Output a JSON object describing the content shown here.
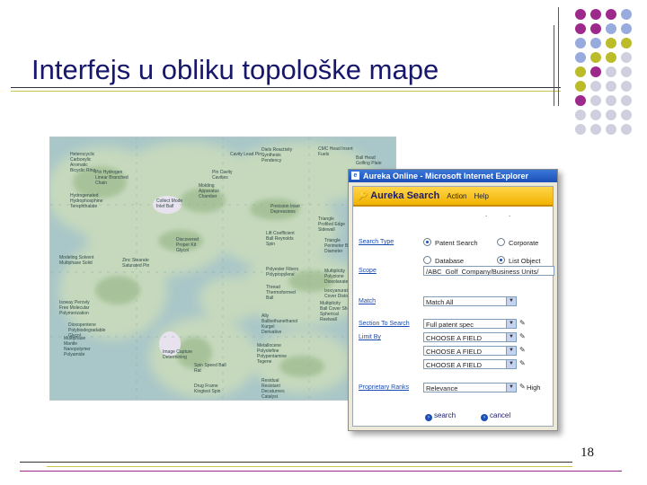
{
  "slide": {
    "title": "Interfejs u obliku topološke mape",
    "page_number": "18",
    "colors": {
      "title": "#17176b",
      "dot_purple": "#9b2a8a",
      "dot_blue": "#99aadd",
      "dot_olive": "#bcbc2a",
      "dot_grey": "#cfcfe0"
    }
  },
  "map": {
    "labels": [
      "Heterocyclic Carboxylic Aromatic Bicyclic Ring",
      "Pin Hydrogen Linear Branched Chain",
      "Hydrogenated Hydrophosphine Terephthalate",
      "Cavity Lead Pin",
      "Pin Cavity Cavities",
      "Diels Reactivity Synthesis Pendency",
      "CMC Head Insert Fuels",
      "Ball Head Golfing Plate",
      "Molding Apparatus Chamber",
      "Collect Mode Inlet Ball",
      "Precision Inset Depressions",
      "Triangle Profiled Edge Sidewall",
      "Discovered Proper Kit Glycol",
      "Lift Coefficient Ball Reynolds Spin",
      "Triangle Perimeter Ball Diameter",
      "Modeling Solvent Multiphase Solid",
      "Zinc Stearate Saturated Pin",
      "Polyester Fibers Polypropylene",
      "Multiplicity Polyzione Dioxolanate",
      "Thread Thermoformed Ball",
      "Isocyanurate Cover Distortion",
      "Isoway Perovly Free Molecular Polymerization",
      "Multiplicity Ball Cover Shell Spherical Reelwall",
      "Dioxopentene Polybiodegradable Glycol",
      "Ally Ballbethanethanol Kurgel Derivative",
      "Multiphase Mantle Nanopolymer Polyamide",
      "Metallocene Polyolefine Polypentamine Tegene",
      "Image Capture Determining",
      "Spin Speed Ball Rat",
      "Residual Resistant Decaturnes Catalyst Converting",
      "Drug Frame Kingtest Spin",
      "Wat"
    ]
  },
  "browser": {
    "window_title": "Aureka Online - Microsoft Internet Explorer",
    "app": {
      "name": "Aureka Search",
      "menu": [
        "Action",
        "Help"
      ],
      "dots": [
        ".",
        "."
      ],
      "fields": {
        "search_type": {
          "label": "Search Type",
          "options": [
            "Patent Search",
            "Corporate"
          ],
          "selected": "Patent Search"
        },
        "scope": {
          "label": "Scope",
          "options": [
            "Database",
            "List Object"
          ],
          "selected": "List Object",
          "value": "/ABC_Golf_Company/Business Units/"
        },
        "match": {
          "label": "Match",
          "value": "Match All"
        },
        "section": {
          "label": "Section To Search",
          "value": "Full patent spec"
        },
        "limit_by": {
          "label": "Limit By",
          "values": [
            "CHOOSE A FIELD",
            "CHOOSE A FIELD",
            "CHOOSE A FIELD"
          ]
        },
        "proprietary": {
          "label": "Proprietary Ranks",
          "value": "Relevance",
          "extra": "High"
        }
      },
      "buttons": {
        "search": "search",
        "cancel": "cancel"
      }
    }
  }
}
